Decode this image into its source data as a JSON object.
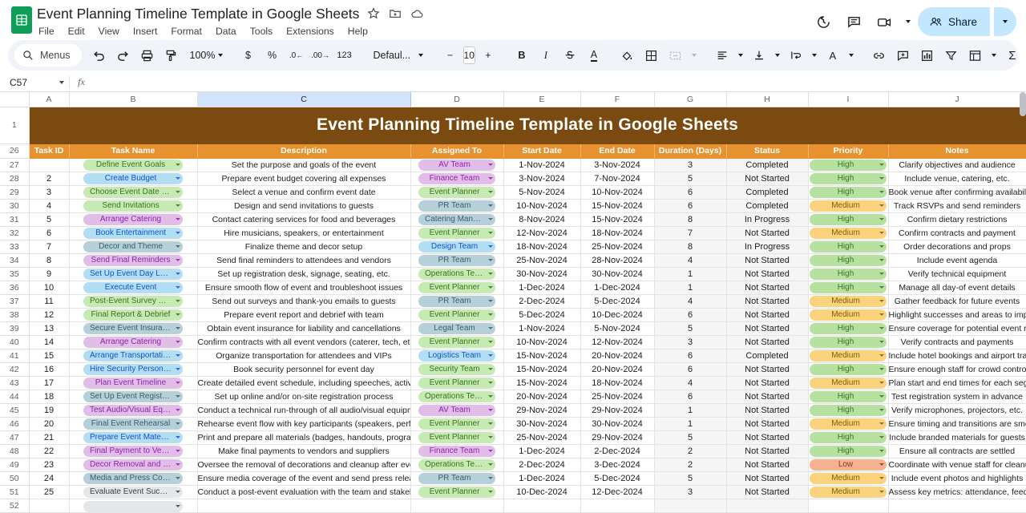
{
  "window": {
    "doc_title": "Event Planning Timeline Template in Google Sheets",
    "logo_name": "google-sheets-logo",
    "title_icons": [
      "star-icon",
      "move-to-folder-icon",
      "cloud-saved-icon"
    ],
    "menus": [
      "File",
      "Edit",
      "View",
      "Insert",
      "Format",
      "Data",
      "Tools",
      "Extensions",
      "Help"
    ],
    "top_right": {
      "history_icon": "version-history-icon",
      "comment_icon": "comment-icon",
      "meet_icon": "google-meet-icon",
      "share_label": "Share",
      "share_color": "#c2e7ff"
    }
  },
  "toolbar": {
    "search_label": "Menus",
    "undo": "undo-icon",
    "redo": "redo-icon",
    "print": "print-icon",
    "paint": "paint-format-icon",
    "zoom_value": "100%",
    "currency": "$",
    "percent": "%",
    "decrease_decimal": ".0",
    "increase_decimal": ".00",
    "more_formats": "123",
    "font_value": "Defaul...",
    "font_size_value": "10",
    "bold": "B",
    "italic": "I",
    "strikethrough": "S",
    "text_color": "A",
    "fill_color": "fill-color-icon",
    "borders": "borders-icon",
    "merge_cells": "merge-cells-icon",
    "halign": "horizontal-align-icon",
    "valign": "vertical-align-icon",
    "text_wrap": "text-wrapping-icon",
    "text_rotation": "text-rotation-icon",
    "link": "insert-link-icon",
    "comment": "insert-comment-icon",
    "chart": "insert-chart-icon",
    "filter": "filter-icon",
    "pivot": "pivot-table-icon",
    "functions": "functions-icon",
    "collapse": "collapse-toolbar-icon"
  },
  "formula_bar": {
    "name_box": "C57",
    "fx_label": "fx",
    "formula_value": ""
  },
  "grid": {
    "columns": [
      "A",
      "B",
      "C",
      "D",
      "E",
      "F",
      "G",
      "H",
      "I",
      "J"
    ],
    "selected_column": "C",
    "banner_row_number": "1",
    "banner_title": "Event Planning Timeline Template in Google Sheets",
    "banner_bg": "#7a4a10",
    "header_row_number": "26",
    "header_bg": "#e8922f",
    "headers": [
      "Task ID",
      "Task Name",
      "Description",
      "Assigned To",
      "Start Date",
      "End Date",
      "Duration (Days)",
      "Status",
      "Priority",
      "Notes"
    ],
    "trailing_row_number": "52",
    "row_numbers": [
      "27",
      "28",
      "29",
      "30",
      "31",
      "32",
      "33",
      "34",
      "35",
      "36",
      "37",
      "38",
      "39",
      "40",
      "41",
      "42",
      "43",
      "44",
      "45",
      "46",
      "47",
      "48",
      "49",
      "50",
      "51"
    ]
  },
  "rows": [
    {
      "id": "",
      "task": "Define Event Goals",
      "task_color": "c-lgreen",
      "desc": "Set the purpose and goals of the event",
      "team": "AV Team",
      "team_color": "c-purple",
      "start": "1-Nov-2024",
      "end": "3-Nov-2024",
      "dur": "3",
      "status": "Completed",
      "prio": "High",
      "prio_color": "c-green",
      "notes": "Clarify objectives and audience"
    },
    {
      "id": "2",
      "task": "Create Budget",
      "task_color": "c-lblue",
      "desc": "Prepare event budget covering all expenses",
      "team": "Finance Team",
      "team_color": "c-purple",
      "start": "3-Nov-2024",
      "end": "7-Nov-2024",
      "dur": "5",
      "status": "Not Started",
      "prio": "High",
      "prio_color": "c-green",
      "notes": "Include venue, catering, etc."
    },
    {
      "id": "3",
      "task": "Choose Event Date and Ven...",
      "task_color": "c-lgreen",
      "desc": "Select a venue and confirm event date",
      "team": "Event Planner",
      "team_color": "c-lgreen",
      "start": "5-Nov-2024",
      "end": "10-Nov-2024",
      "dur": "6",
      "status": "Completed",
      "prio": "High",
      "prio_color": "c-green",
      "notes": "Book venue after confirming availability"
    },
    {
      "id": "4",
      "task": "Send Invitations",
      "task_color": "c-lgreen",
      "desc": "Design and send invitations to guests",
      "team": "PR Team",
      "team_color": "c-steel",
      "start": "10-Nov-2024",
      "end": "15-Nov-2024",
      "dur": "6",
      "status": "Completed",
      "prio": "Medium",
      "prio_color": "c-amber",
      "notes": "Track RSVPs and send reminders"
    },
    {
      "id": "5",
      "task": "Arrange Catering",
      "task_color": "c-purple",
      "desc": "Contact catering services for food and beverages",
      "team": "Catering Manager",
      "team_color": "c-steel",
      "start": "8-Nov-2024",
      "end": "15-Nov-2024",
      "dur": "8",
      "status": "In Progress",
      "prio": "High",
      "prio_color": "c-green",
      "notes": "Confirm dietary restrictions"
    },
    {
      "id": "6",
      "task": "Book Entertainment",
      "task_color": "c-lblue",
      "desc": "Hire musicians, speakers, or entertainment",
      "team": "Event Planner",
      "team_color": "c-lgreen",
      "start": "12-Nov-2024",
      "end": "18-Nov-2024",
      "dur": "7",
      "status": "Not Started",
      "prio": "Medium",
      "prio_color": "c-amber",
      "notes": "Confirm contracts and payment"
    },
    {
      "id": "7",
      "task": "Decor and Theme",
      "task_color": "c-steel",
      "desc": "Finalize theme and decor setup",
      "team": "Design Team",
      "team_color": "c-lblue",
      "start": "18-Nov-2024",
      "end": "25-Nov-2024",
      "dur": "8",
      "status": "In Progress",
      "prio": "High",
      "prio_color": "c-green",
      "notes": "Order decorations and props"
    },
    {
      "id": "8",
      "task": "Send Final Reminders",
      "task_color": "c-purple",
      "desc": "Send final reminders to attendees and vendors",
      "team": "PR Team",
      "team_color": "c-steel",
      "start": "25-Nov-2024",
      "end": "28-Nov-2024",
      "dur": "4",
      "status": "Not Started",
      "prio": "High",
      "prio_color": "c-green",
      "notes": "Include event agenda"
    },
    {
      "id": "9",
      "task": "Set Up Event Day Logistics",
      "task_color": "c-lblue",
      "desc": "Set up registration desk, signage, seating, etc.",
      "team": "Operations Team",
      "team_color": "c-lgreen",
      "start": "30-Nov-2024",
      "end": "30-Nov-2024",
      "dur": "1",
      "status": "Not Started",
      "prio": "High",
      "prio_color": "c-green",
      "notes": "Verify technical equipment"
    },
    {
      "id": "10",
      "task": "Execute Event",
      "task_color": "c-lblue",
      "desc": "Ensure smooth flow of event and troubleshoot issues",
      "team": "Event Planner",
      "team_color": "c-lgreen",
      "start": "1-Dec-2024",
      "end": "1-Dec-2024",
      "dur": "1",
      "status": "Not Started",
      "prio": "High",
      "prio_color": "c-green",
      "notes": "Manage all day-of event details"
    },
    {
      "id": "11",
      "task": "Post-Event Survey & Thank ...",
      "task_color": "c-lgreen",
      "desc": "Send out surveys and thank-you emails to guests",
      "team": "PR Team",
      "team_color": "c-steel",
      "start": "2-Dec-2024",
      "end": "5-Dec-2024",
      "dur": "4",
      "status": "Not Started",
      "prio": "Medium",
      "prio_color": "c-amber",
      "notes": "Gather feedback for future events"
    },
    {
      "id": "12",
      "task": "Final Report & Debrief",
      "task_color": "c-lgreen",
      "desc": "Prepare event report and debrief with team",
      "team": "Event Planner",
      "team_color": "c-lgreen",
      "start": "5-Dec-2024",
      "end": "10-Dec-2024",
      "dur": "6",
      "status": "Not Started",
      "prio": "Medium",
      "prio_color": "c-amber",
      "notes": "Highlight successes and areas to improve"
    },
    {
      "id": "13",
      "task": "Secure Event Insurance",
      "task_color": "c-steel",
      "desc": "Obtain event insurance for liability and cancellations",
      "team": "Legal Team",
      "team_color": "c-steel",
      "start": "1-Nov-2024",
      "end": "5-Nov-2024",
      "dur": "5",
      "status": "Not Started",
      "prio": "High",
      "prio_color": "c-green",
      "notes": "Ensure coverage for potential event risks"
    },
    {
      "id": "14",
      "task": "Arrange Catering",
      "task_color": "c-purple",
      "desc": "Confirm contracts with all event vendors (caterer, tech, etc.)",
      "team": "Event Planner",
      "team_color": "c-lgreen",
      "start": "10-Nov-2024",
      "end": "12-Nov-2024",
      "dur": "3",
      "status": "Not Started",
      "prio": "High",
      "prio_color": "c-green",
      "notes": "Verify contracts and payments"
    },
    {
      "id": "15",
      "task": "Arrange Transportation",
      "task_color": "c-lblue",
      "desc": "Organize transportation for attendees and VIPs",
      "team": "Logistics Team",
      "team_color": "c-lblue",
      "start": "15-Nov-2024",
      "end": "20-Nov-2024",
      "dur": "6",
      "status": "Completed",
      "prio": "Medium",
      "prio_color": "c-amber",
      "notes": "Include hotel bookings and airport transfers"
    },
    {
      "id": "16",
      "task": "Hire Security Personnel",
      "task_color": "c-lblue",
      "desc": "Book security personnel for event day",
      "team": "Security Team",
      "team_color": "c-lgreen",
      "start": "15-Nov-2024",
      "end": "20-Nov-2024",
      "dur": "6",
      "status": "Not Started",
      "prio": "High",
      "prio_color": "c-green",
      "notes": "Ensure enough staff for crowd control"
    },
    {
      "id": "17",
      "task": "Plan Event Timeline",
      "task_color": "c-purple",
      "desc": "Create detailed event schedule, including speeches, activities",
      "team": "Event Planner",
      "team_color": "c-lgreen",
      "start": "15-Nov-2024",
      "end": "18-Nov-2024",
      "dur": "4",
      "status": "Not Started",
      "prio": "Medium",
      "prio_color": "c-amber",
      "notes": "Plan start and end times for each segment"
    },
    {
      "id": "18",
      "task": "Set Up Event Registration",
      "task_color": "c-steel",
      "desc": "Set up online and/or on-site registration process",
      "team": "Operations Team",
      "team_color": "c-lgreen",
      "start": "20-Nov-2024",
      "end": "25-Nov-2024",
      "dur": "6",
      "status": "Not Started",
      "prio": "High",
      "prio_color": "c-green",
      "notes": "Test registration system in advance"
    },
    {
      "id": "19",
      "task": "Test Audio/Visual Equipment",
      "task_color": "c-purple",
      "desc": "Conduct a technical run-through of all audio/visual equipment",
      "team": "AV Team",
      "team_color": "c-purple",
      "start": "29-Nov-2024",
      "end": "29-Nov-2024",
      "dur": "1",
      "status": "Not Started",
      "prio": "High",
      "prio_color": "c-green",
      "notes": "Verify microphones, projectors, etc."
    },
    {
      "id": "20",
      "task": "Final Event Rehearsal",
      "task_color": "c-steel",
      "desc": "Rehearse event flow with key participants (speakers, performers)",
      "team": "Event Planner",
      "team_color": "c-lgreen",
      "start": "30-Nov-2024",
      "end": "30-Nov-2024",
      "dur": "1",
      "status": "Not Started",
      "prio": "Medium",
      "prio_color": "c-amber",
      "notes": "Ensure timing and transitions are smooth"
    },
    {
      "id": "21",
      "task": "Prepare Event Materials",
      "task_color": "c-lblue",
      "desc": "Print and prepare all materials (badges, handouts, programs)",
      "team": "Event Planner",
      "team_color": "c-lgreen",
      "start": "25-Nov-2024",
      "end": "29-Nov-2024",
      "dur": "5",
      "status": "Not Started",
      "prio": "High",
      "prio_color": "c-green",
      "notes": "Include branded materials for guests"
    },
    {
      "id": "22",
      "task": "Final Payment to Vendors",
      "task_color": "c-purple",
      "desc": "Make final payments to vendors and suppliers",
      "team": "Finance Team",
      "team_color": "c-purple",
      "start": "1-Dec-2024",
      "end": "2-Dec-2024",
      "dur": "2",
      "status": "Not Started",
      "prio": "High",
      "prio_color": "c-green",
      "notes": "Ensure all contracts are settled"
    },
    {
      "id": "23",
      "task": "Decor Removal and Clean-Up",
      "task_color": "c-purple",
      "desc": "Oversee the removal of decorations and cleanup after event",
      "team": "Operations Team",
      "team_color": "c-lgreen",
      "start": "2-Dec-2024",
      "end": "3-Dec-2024",
      "dur": "2",
      "status": "Not Started",
      "prio": "Low",
      "prio_color": "c-salmon",
      "notes": "Coordinate with venue staff for cleanup"
    },
    {
      "id": "24",
      "task": "Media and Press Coverage",
      "task_color": "c-steel",
      "desc": "Ensure media coverage of the event and send press releases",
      "team": "PR Team",
      "team_color": "c-steel",
      "start": "1-Dec-2024",
      "end": "5-Dec-2024",
      "dur": "5",
      "status": "Not Started",
      "prio": "Medium",
      "prio_color": "c-amber",
      "notes": "Include event photos and highlights"
    },
    {
      "id": "25",
      "task": "Evaluate Event Success",
      "task_color": "c-gray",
      "desc": "Conduct a post-event evaluation with the team and stakeholders",
      "team": "Event Planner",
      "team_color": "c-lgreen",
      "start": "10-Dec-2024",
      "end": "12-Dec-2024",
      "dur": "3",
      "status": "Not Started",
      "prio": "Medium",
      "prio_color": "c-amber",
      "notes": "Assess key metrics: attendance, feedback, etc."
    }
  ]
}
